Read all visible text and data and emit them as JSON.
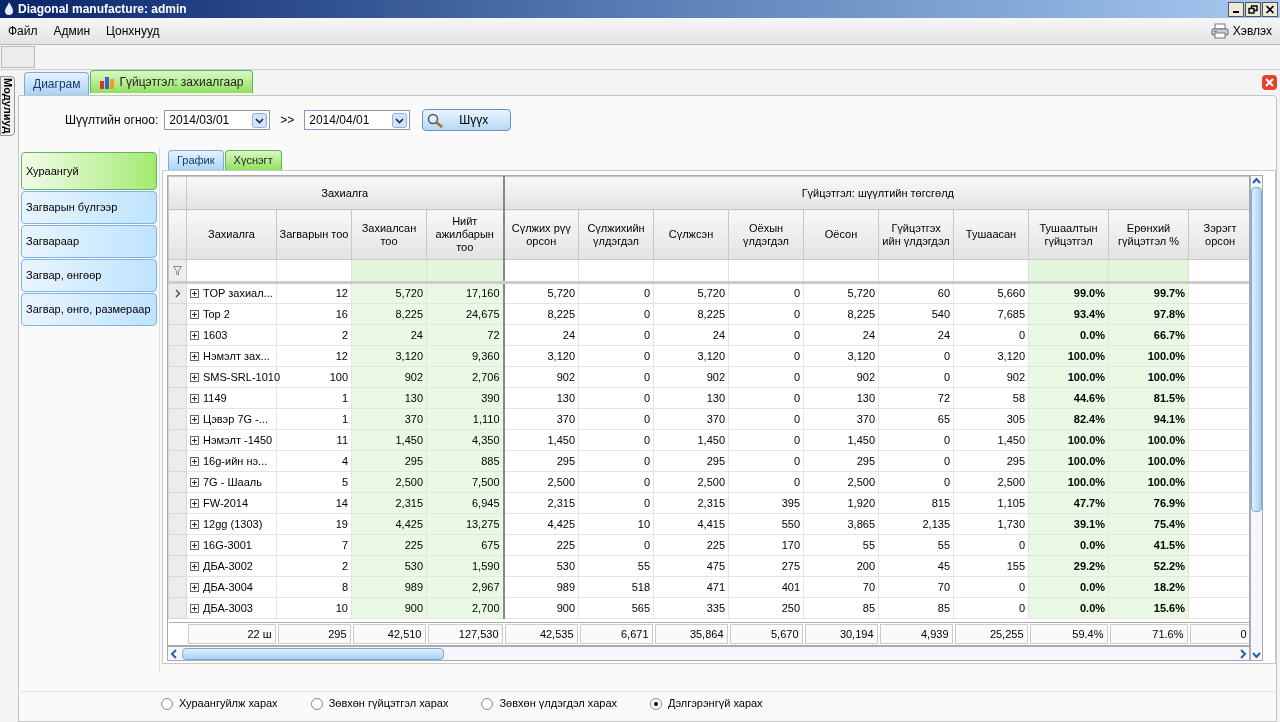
{
  "window": {
    "title": "Diagonal manufacture: admin"
  },
  "menu": [
    {
      "label": "Файл"
    },
    {
      "label": "Админ"
    },
    {
      "label": "Цонхнууд"
    }
  ],
  "print_button": {
    "label": "Хэвлэх"
  },
  "side_tab": {
    "label": "Модулиуд"
  },
  "tabs": [
    {
      "label": "Диаграм",
      "selected": false
    },
    {
      "label": "Гүйцэтгэл: захиалгаар",
      "selected": true
    }
  ],
  "filter": {
    "label": "Шүүлтийн огноо:",
    "from": "2014/03/01",
    "separator": ">>",
    "to": "2014/04/01",
    "button": "Шүүх"
  },
  "groupings": [
    {
      "label": "Хураангуй",
      "selected": true
    },
    {
      "label": "Загварын бүлгээр",
      "selected": false
    },
    {
      "label": "Загвараар",
      "selected": false
    },
    {
      "label": "Загвар, өнгөөр",
      "selected": false
    },
    {
      "label": "Загвар, өнгө, размераар",
      "selected": false
    }
  ],
  "view_tabs": [
    {
      "label": "График",
      "selected": false
    },
    {
      "label": "Хүснэгт",
      "selected": true
    }
  ],
  "table": {
    "column_groups": [
      {
        "label": "Захиалга"
      },
      {
        "label": "Гүйцэтгэл: шүүлтийн төгсгөлд"
      }
    ],
    "columns": [
      {
        "label": "Захиалга",
        "highlighted": false,
        "bold": false
      },
      {
        "label": "Загварын тоо",
        "highlighted": false,
        "bold": false
      },
      {
        "label": "Захиалсан тоо",
        "highlighted": true,
        "bold": false
      },
      {
        "label": "Нийт ажилбарын тоо",
        "highlighted": true,
        "bold": false
      },
      {
        "label": "Сүлжих рүү орсон",
        "highlighted": false,
        "bold": false
      },
      {
        "label": "Сүлжихийн үлдэгдэл",
        "highlighted": false,
        "bold": false
      },
      {
        "label": "Сүлжсэн",
        "highlighted": false,
        "bold": false
      },
      {
        "label": "Оёхын үлдэгдэл",
        "highlighted": false,
        "bold": false
      },
      {
        "label": "Оёсон",
        "highlighted": false,
        "bold": false
      },
      {
        "label": "Гүйцэтгэх ийн үлдэгдэл",
        "highlighted": false,
        "bold": false
      },
      {
        "label": "Тушаасан",
        "highlighted": false,
        "bold": false
      },
      {
        "label": "Тушаалтын гүйцэтгэл",
        "highlighted": true,
        "bold": true
      },
      {
        "label": "Ерөнхий гүйцэтгэл %",
        "highlighted": true,
        "bold": true
      },
      {
        "label": "Зэрэгт орсон",
        "highlighted": false,
        "bold": false
      }
    ],
    "rows": [
      {
        "selected": true,
        "cells": [
          "TOP захиал...",
          "12",
          "5,720",
          "17,160",
          "5,720",
          "0",
          "5,720",
          "0",
          "5,720",
          "60",
          "5,660",
          "99.0%",
          "99.7%",
          ""
        ]
      },
      {
        "selected": false,
        "cells": [
          "Top 2",
          "16",
          "8,225",
          "24,675",
          "8,225",
          "0",
          "8,225",
          "0",
          "8,225",
          "540",
          "7,685",
          "93.4%",
          "97.8%",
          ""
        ]
      },
      {
        "selected": false,
        "cells": [
          "1603",
          "2",
          "24",
          "72",
          "24",
          "0",
          "24",
          "0",
          "24",
          "24",
          "0",
          "0.0%",
          "66.7%",
          ""
        ]
      },
      {
        "selected": false,
        "cells": [
          "Нэмэлт зах...",
          "12",
          "3,120",
          "9,360",
          "3,120",
          "0",
          "3,120",
          "0",
          "3,120",
          "0",
          "3,120",
          "100.0%",
          "100.0%",
          ""
        ]
      },
      {
        "selected": false,
        "cells": [
          "SMS-SRL-1010",
          "100",
          "902",
          "2,706",
          "902",
          "0",
          "902",
          "0",
          "902",
          "0",
          "902",
          "100.0%",
          "100.0%",
          ""
        ]
      },
      {
        "selected": false,
        "cells": [
          "1149",
          "1",
          "130",
          "390",
          "130",
          "0",
          "130",
          "0",
          "130",
          "72",
          "58",
          "44.6%",
          "81.5%",
          ""
        ]
      },
      {
        "selected": false,
        "cells": [
          "Цэвэр 7G -...",
          "1",
          "370",
          "1,110",
          "370",
          "0",
          "370",
          "0",
          "370",
          "65",
          "305",
          "82.4%",
          "94.1%",
          ""
        ]
      },
      {
        "selected": false,
        "cells": [
          "Нэмэлт -1450",
          "11",
          "1,450",
          "4,350",
          "1,450",
          "0",
          "1,450",
          "0",
          "1,450",
          "0",
          "1,450",
          "100.0%",
          "100.0%",
          ""
        ]
      },
      {
        "selected": false,
        "cells": [
          "16g-ийн нэ...",
          "4",
          "295",
          "885",
          "295",
          "0",
          "295",
          "0",
          "295",
          "0",
          "295",
          "100.0%",
          "100.0%",
          ""
        ]
      },
      {
        "selected": false,
        "cells": [
          "7G - Шааль",
          "5",
          "2,500",
          "7,500",
          "2,500",
          "0",
          "2,500",
          "0",
          "2,500",
          "0",
          "2,500",
          "100.0%",
          "100.0%",
          ""
        ]
      },
      {
        "selected": false,
        "cells": [
          "FW-2014",
          "14",
          "2,315",
          "6,945",
          "2,315",
          "0",
          "2,315",
          "395",
          "1,920",
          "815",
          "1,105",
          "47.7%",
          "76.9%",
          ""
        ]
      },
      {
        "selected": false,
        "cells": [
          "12gg (1303)",
          "19",
          "4,425",
          "13,275",
          "4,425",
          "10",
          "4,415",
          "550",
          "3,865",
          "2,135",
          "1,730",
          "39.1%",
          "75.4%",
          ""
        ]
      },
      {
        "selected": false,
        "cells": [
          "16G-3001",
          "7",
          "225",
          "675",
          "225",
          "0",
          "225",
          "170",
          "55",
          "55",
          "0",
          "0.0%",
          "41.5%",
          ""
        ]
      },
      {
        "selected": false,
        "cells": [
          "ДБА-3002",
          "2",
          "530",
          "1,590",
          "530",
          "55",
          "475",
          "275",
          "200",
          "45",
          "155",
          "29.2%",
          "52.2%",
          ""
        ]
      },
      {
        "selected": false,
        "cells": [
          "ДБА-3004",
          "8",
          "989",
          "2,967",
          "989",
          "518",
          "471",
          "401",
          "70",
          "70",
          "0",
          "0.0%",
          "18.2%",
          ""
        ]
      },
      {
        "selected": false,
        "cells": [
          "ДБА-3003",
          "10",
          "900",
          "2,700",
          "900",
          "565",
          "335",
          "250",
          "85",
          "85",
          "0",
          "0.0%",
          "15.6%",
          ""
        ]
      }
    ],
    "footer": [
      "22 ш",
      "295",
      "42,510",
      "127,530",
      "42,535",
      "6,671",
      "35,864",
      "5,670",
      "30,194",
      "4,939",
      "25,255",
      "59.4%",
      "71.6%",
      "0"
    ]
  },
  "view_options": [
    {
      "label": "Хураангуйлж харах",
      "selected": false
    },
    {
      "label": "Зөвхөн гүйцэтгэл харах",
      "selected": false
    },
    {
      "label": "Зөвхөн үлдэгдэл харах",
      "selected": false
    },
    {
      "label": "Дэлгэрэнгүй харах",
      "selected": true
    }
  ]
}
